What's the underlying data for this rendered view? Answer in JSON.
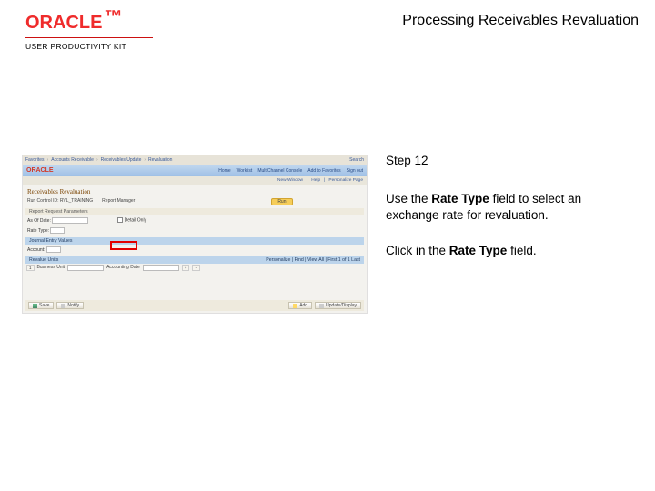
{
  "header": {
    "logo": {
      "text": "ORACLE",
      "tm": "™",
      "subtitle": "USER PRODUCTIVITY KIT"
    },
    "title": "Processing Receivables Revaluation"
  },
  "instructions": {
    "step": "Step 12",
    "line1": {
      "a": "Use the ",
      "b": "Rate Type",
      "c": " field to select an exchange rate for revaluation."
    },
    "line2": {
      "a": "Click in the ",
      "b": "Rate Type",
      "c": " field."
    }
  },
  "shot": {
    "breadcrumb": [
      "Favorites",
      "Accounts Receivable",
      "Receivables Update",
      "Revaluation"
    ],
    "breadcrumb_end": "Search",
    "topbar": {
      "logo": "ORACLE",
      "links": [
        "Home",
        "Worklist",
        "MultiChannel Console",
        "Add to Favorites",
        "Sign out"
      ]
    },
    "sub": [
      "New Window",
      "Help",
      "Personalize Page"
    ],
    "page_title": "Receivables Revaluation",
    "run": {
      "label": "Run Control ID:",
      "value": "RVL_TRAINING"
    },
    "report_mgr": "Report Manager",
    "run_btn": "Run",
    "sections": {
      "params": "Report Request Parameters",
      "journal": "Journal Entry Values",
      "revalue": "Revalue Units",
      "tools": "Personalize | Find | View All | First 1 of 1 Last"
    },
    "form": {
      "asof_label": "As Of Date:",
      "detail_label": "Detail Only",
      "rate_label": "Rate Type:",
      "acct_label": "Account:"
    },
    "grid": {
      "row_num": "1",
      "unit_label": "Business Unit",
      "date_label": "Accounting Date"
    },
    "buttons": {
      "save": "Save",
      "notify": "Notify",
      "add": "Add",
      "update": "Update/Display"
    }
  }
}
